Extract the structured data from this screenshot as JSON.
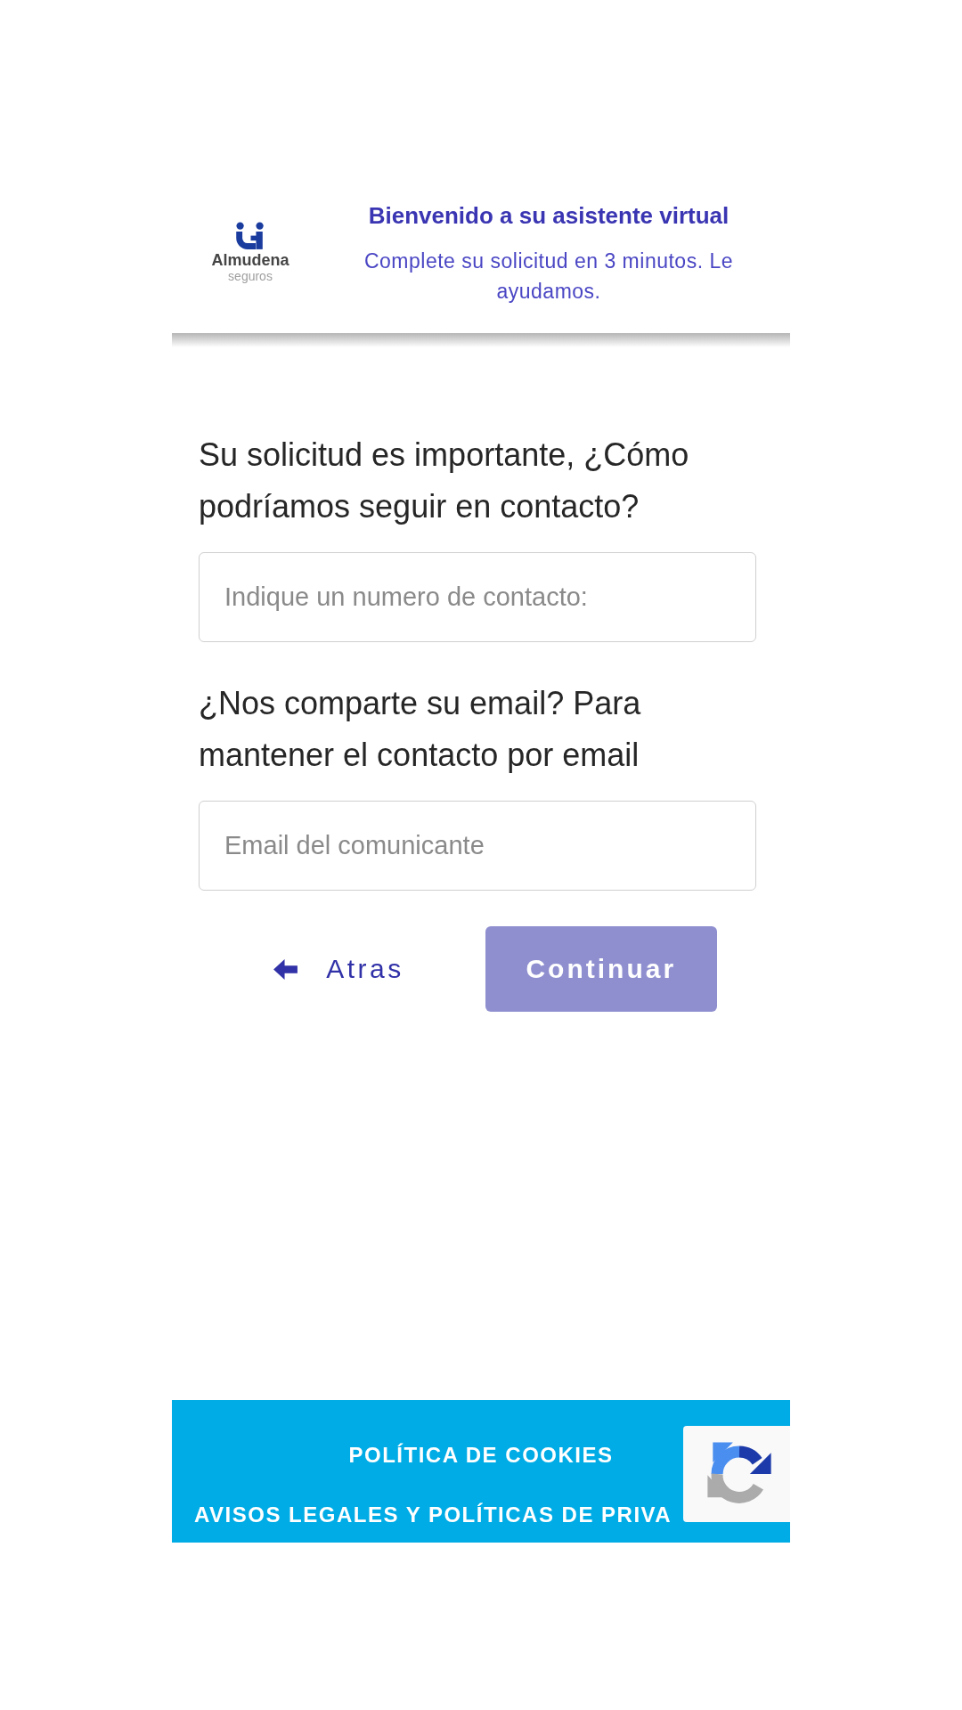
{
  "header": {
    "logo": {
      "wordmark": "Almudena",
      "tagline": "seguros"
    },
    "title": "Bienvenido a su asistente virtual",
    "subtitle": "Complete su solicitud en 3 minutos. Le ayudamos."
  },
  "form": {
    "questions": [
      {
        "label": "Su solicitud es importante, ¿Cómo podríamos seguir en contacto?",
        "placeholder": "Indique un numero de contacto:"
      },
      {
        "label": "¿Nos comparte su email? Para mantener el contacto por email",
        "placeholder": "Email del comunicante"
      }
    ],
    "buttons": [
      {
        "kind": "back",
        "label": "Atras",
        "disabled": false
      },
      {
        "kind": "primary",
        "label": "Continuar",
        "disabled": true
      }
    ]
  },
  "footer": {
    "links": [
      "POLÍTICA DE COOKIES",
      "AVISOS LEGALES Y POLÍTICAS DE PRIVA"
    ]
  }
}
